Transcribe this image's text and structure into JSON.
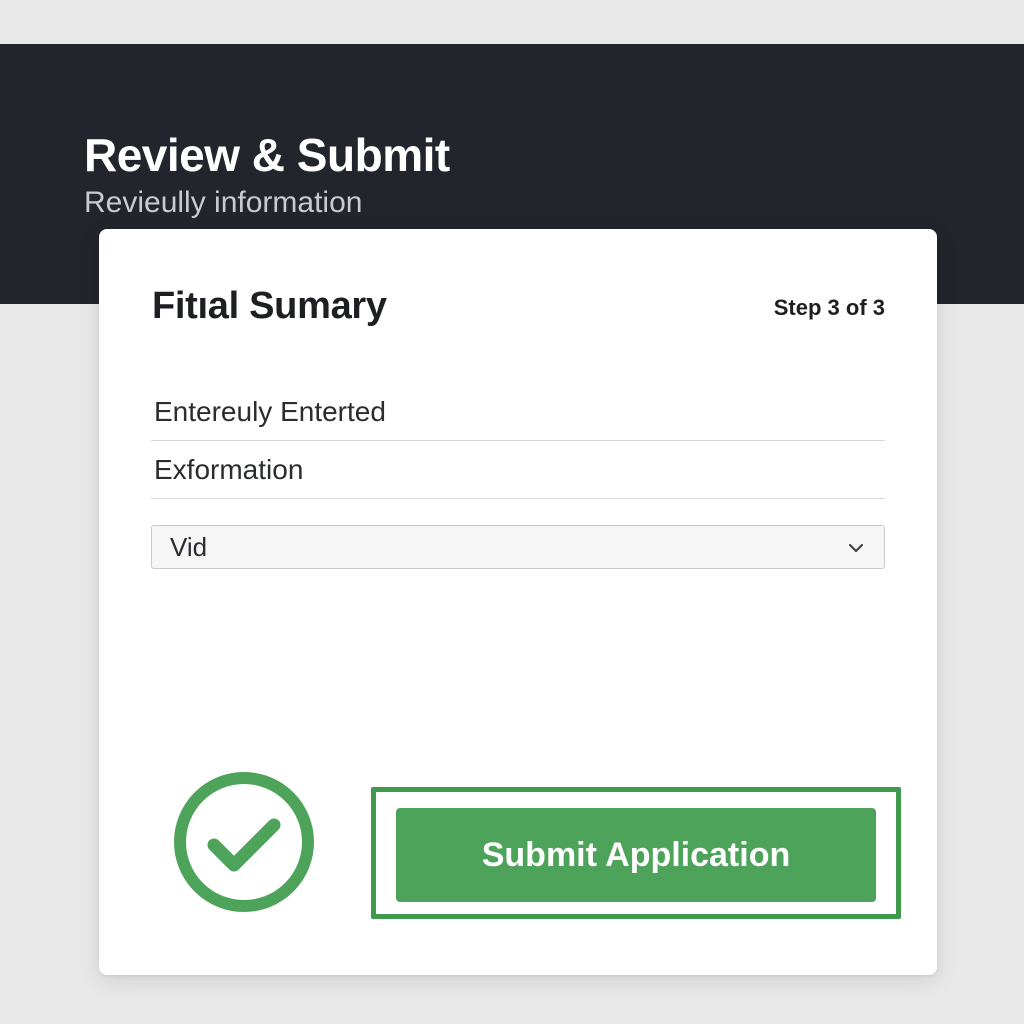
{
  "header": {
    "title": "Review & Submit",
    "subtitle": "Revieully information"
  },
  "card": {
    "title": "Fitıal Sumary",
    "step": "Step 3 of 3",
    "fields": [
      {
        "text": "Entereuly Enterted"
      },
      {
        "text": "Exformation"
      }
    ],
    "select": {
      "value": "Vid",
      "icon": "chevron-down-icon"
    },
    "status_icon": "check-circle-icon",
    "submit_label": "Submit Application"
  },
  "colors": {
    "header_bg": "#22252b",
    "accent_green": "#4ea35a",
    "frame_green": "#3f9a4d",
    "page_bg": "#e8e8e9"
  }
}
